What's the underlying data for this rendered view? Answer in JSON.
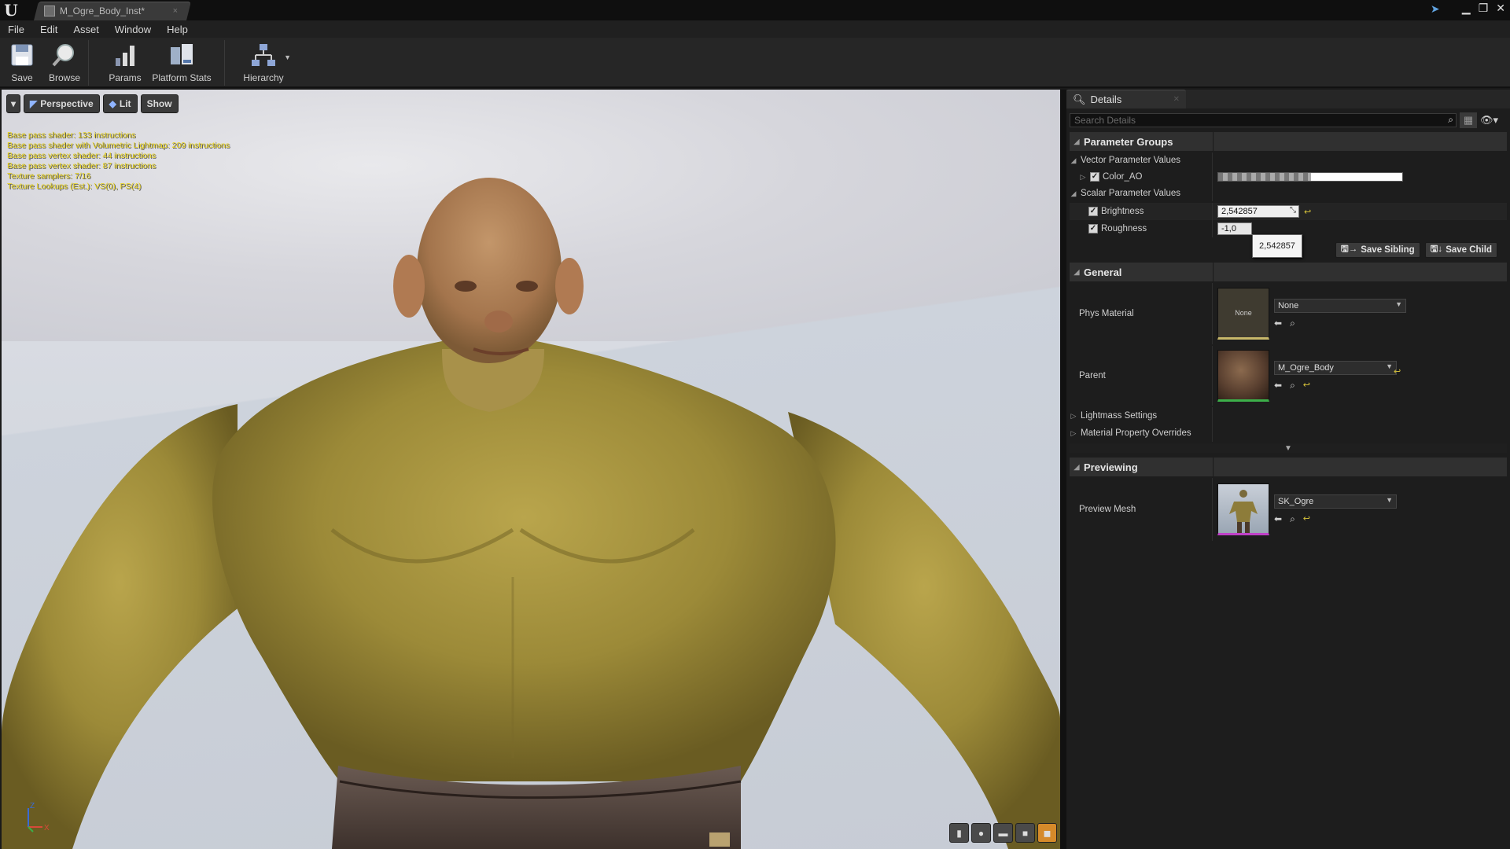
{
  "window": {
    "tab_title": "M_Ogre_Body_Inst*",
    "tab_close": "×",
    "controls": {
      "pin": "➤",
      "minimize": "▁",
      "restore": "❐",
      "close": "✕"
    }
  },
  "menu": [
    "File",
    "Edit",
    "Asset",
    "Window",
    "Help"
  ],
  "toolbar": {
    "save": "Save",
    "browse": "Browse",
    "params": "Params",
    "platform_stats": "Platform Stats",
    "hierarchy": "Hierarchy"
  },
  "viewport": {
    "buttons": {
      "perspective": "Perspective",
      "lit": "Lit",
      "show": "Show"
    },
    "stats": [
      "Base pass shader: 133 instructions",
      "Base pass shader with Volumetric Lightmap: 209 instructions",
      "Base pass vertex shader: 44 instructions",
      "Base pass vertex shader: 87 instructions",
      "Texture samplers: 7/16",
      "Texture Lookups (Est.): VS(0), PS(4)"
    ],
    "axis": {
      "z": "Z",
      "x": "X"
    }
  },
  "details": {
    "tab_label": "Details",
    "search_placeholder": "Search Details",
    "parameter_groups": "Parameter Groups",
    "vector_params": "Vector Parameter Values",
    "color_ao": "Color_AO",
    "scalar_params": "Scalar Parameter Values",
    "brightness_label": "Brightness",
    "brightness_value": "2,542857",
    "brightness_tooltip": "2,542857",
    "roughness_label": "Roughness",
    "roughness_value": "-1,0",
    "save_sibling": "Save Sibling",
    "save_child": "Save Child",
    "general": "General",
    "phys_material_label": "Phys Material",
    "phys_material_thumb": "None",
    "phys_material_value": "None",
    "parent_label": "Parent",
    "parent_value": "M_Ogre_Body",
    "lightmass": "Lightmass Settings",
    "material_overrides": "Material Property Overrides",
    "previewing": "Previewing",
    "preview_mesh_label": "Preview Mesh",
    "preview_mesh_value": "SK_Ogre"
  },
  "colors": {
    "accent_orange": "#d58a2a",
    "stats_yellow": "#e8d21a",
    "reset_yellow": "#d6c23a"
  }
}
